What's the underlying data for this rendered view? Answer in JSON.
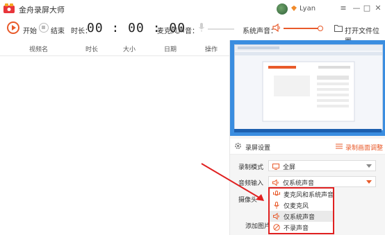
{
  "app": {
    "title": "金舟录屏大师",
    "user_name": "Lyan"
  },
  "toolbar": {
    "start_label": "开始",
    "stop_label": "结束",
    "duration_label": "时长：",
    "timer": "00 : 00 : 00",
    "mic_label": "麦克风声音：",
    "system_sound_label": "系统声音：",
    "open_folder_label": "打开文件位置"
  },
  "table": {
    "columns": [
      "视频名",
      "时长",
      "大小",
      "日期",
      "操作"
    ]
  },
  "settings": {
    "title": "录屏设置",
    "adjust_link": "录制画面调整",
    "record_mode_label": "录制模式",
    "record_mode_value": "全屏",
    "audio_input_label": "音频输入",
    "audio_input_value": "仅系统声音",
    "camera_label": "摄像头",
    "add_image_label": "添加图片"
  },
  "audio_options": [
    {
      "label": "麦克风和系统声音",
      "icon": "mic-speaker-icon"
    },
    {
      "label": "仅麦克风",
      "icon": "mic-icon"
    },
    {
      "label": "仅系统声音",
      "icon": "speaker-icon",
      "selected": true
    },
    {
      "label": "不录声音",
      "icon": "no-sound-icon"
    }
  ],
  "colors": {
    "accent": "#e85a2a",
    "highlight_border": "#e02020",
    "preview_desktop": "#3a8de0"
  }
}
